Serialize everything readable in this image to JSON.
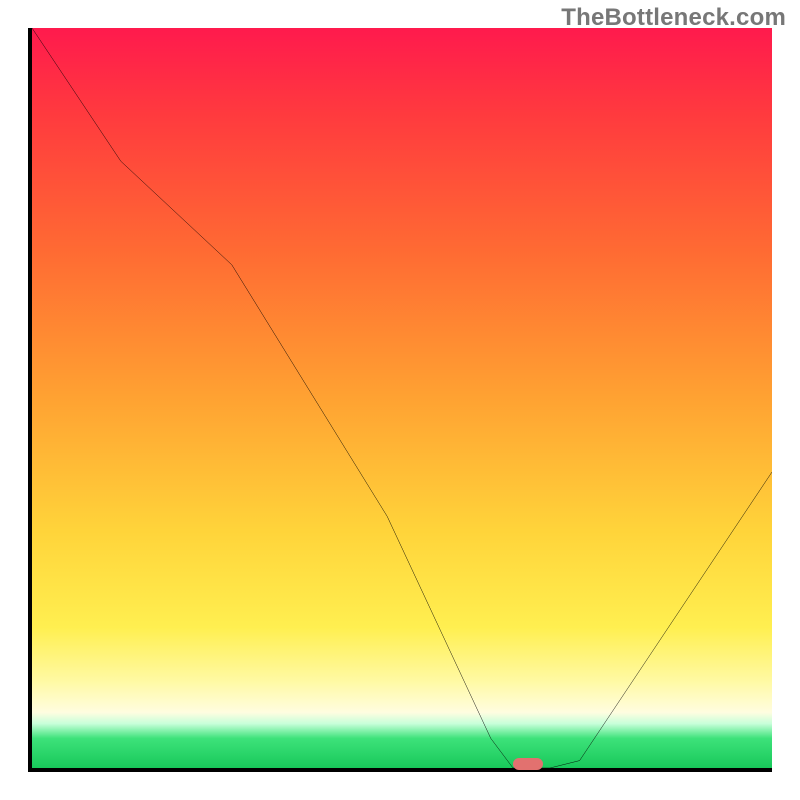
{
  "watermark": "TheBottleneck.com",
  "chart_data": {
    "type": "line",
    "title": "",
    "xlabel": "",
    "ylabel": "",
    "xlim": [
      0,
      100
    ],
    "ylim": [
      0,
      100
    ],
    "grid": false,
    "legend": false,
    "series": [
      {
        "name": "bottleneck-curve",
        "x": [
          0,
          12,
          27,
          48,
          62,
          65,
          70,
          74,
          100
        ],
        "y": [
          100,
          82,
          68,
          34,
          4,
          0,
          0,
          1,
          40
        ]
      }
    ],
    "minimum_marker": {
      "x": 67,
      "y": 0,
      "color": "#e2716f"
    },
    "gradient_bands": [
      {
        "pos": 0,
        "color": "#ff1a4d"
      },
      {
        "pos": 0.12,
        "color": "#ff3b3e"
      },
      {
        "pos": 0.3,
        "color": "#ff6a33"
      },
      {
        "pos": 0.5,
        "color": "#ffa232"
      },
      {
        "pos": 0.68,
        "color": "#ffd43a"
      },
      {
        "pos": 0.81,
        "color": "#ffef50"
      },
      {
        "pos": 0.88,
        "color": "#fff9a0"
      },
      {
        "pos": 0.925,
        "color": "#fffde0"
      },
      {
        "pos": 0.94,
        "color": "#c8ffda"
      },
      {
        "pos": 0.96,
        "color": "#3de27a"
      },
      {
        "pos": 1.0,
        "color": "#18c85a"
      }
    ]
  },
  "colors": {
    "curve": "#000000",
    "axis": "#000000",
    "marker": "#e2716f",
    "watermark": "#777777"
  }
}
